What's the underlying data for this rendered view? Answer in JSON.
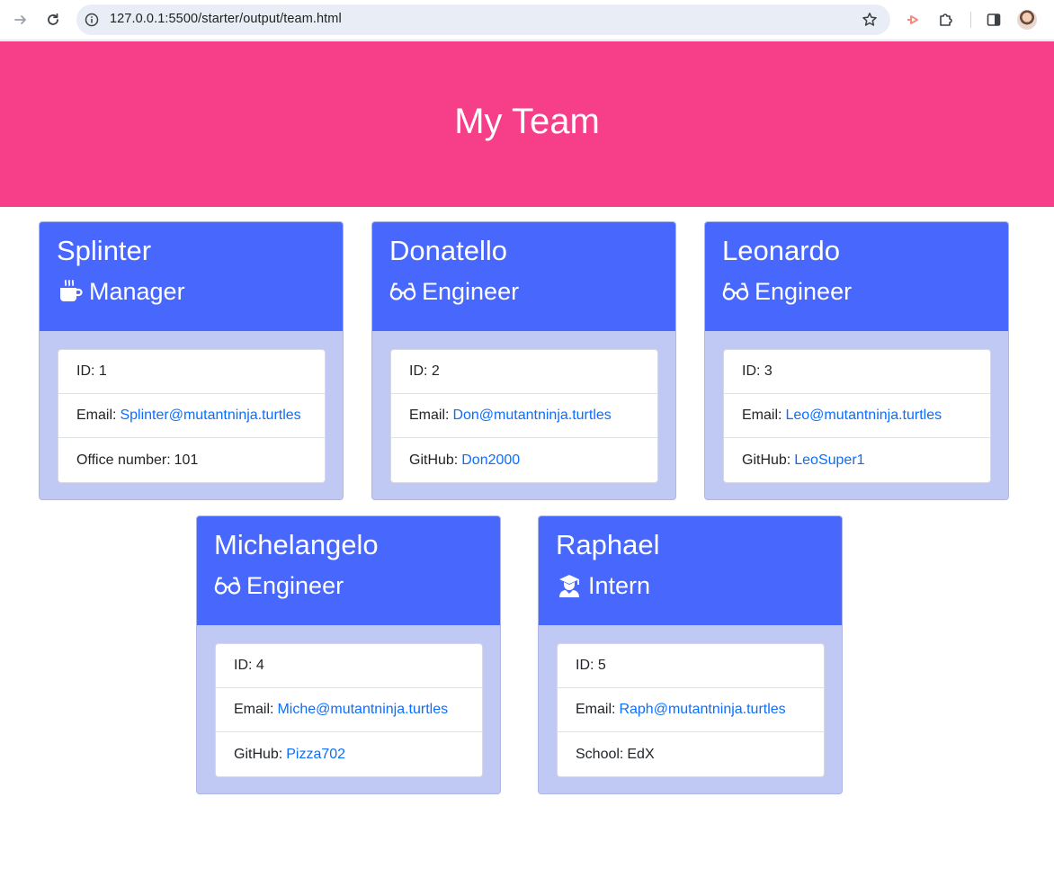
{
  "browser": {
    "url": "127.0.0.1:5500/starter/output/team.html"
  },
  "page": {
    "title": "My Team"
  },
  "colors": {
    "jumbotron": "#f63e89",
    "card_header": "#4867fc",
    "card_body": "#c0c8f4",
    "link": "#0d6efd"
  },
  "team": [
    {
      "name": "Splinter",
      "role": "Manager",
      "icon": "mug-icon",
      "id_label": "ID:",
      "id": "1",
      "email_label": "Email:",
      "email": "Splinter@mutantninja.turtles",
      "extra_label": "Office number:",
      "extra": "101"
    },
    {
      "name": "Donatello",
      "role": "Engineer",
      "icon": "glasses-icon",
      "id_label": "ID:",
      "id": "2",
      "email_label": "Email:",
      "email": "Don@mutantninja.turtles",
      "extra_label": "GitHub:",
      "extra": "Don2000"
    },
    {
      "name": "Leonardo",
      "role": "Engineer",
      "icon": "glasses-icon",
      "id_label": "ID:",
      "id": "3",
      "email_label": "Email:",
      "email": "Leo@mutantninja.turtles",
      "extra_label": "GitHub:",
      "extra": "LeoSuper1"
    },
    {
      "name": "Michelangelo",
      "role": "Engineer",
      "icon": "glasses-icon",
      "id_label": "ID:",
      "id": "4",
      "email_label": "Email:",
      "email": "Miche@mutantninja.turtles",
      "extra_label": "GitHub:",
      "extra": "Pizza702"
    },
    {
      "name": "Raphael",
      "role": "Intern",
      "icon": "graduate-icon",
      "id_label": "ID:",
      "id": "5",
      "email_label": "Email:",
      "email": "Raph@mutantninja.turtles",
      "extra_label": "School:",
      "extra": "EdX"
    }
  ]
}
